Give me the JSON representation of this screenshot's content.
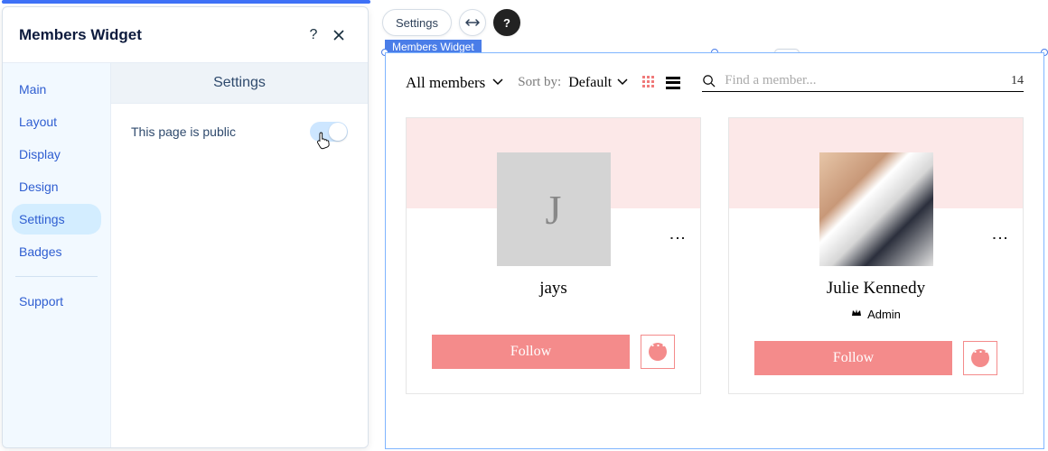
{
  "panel": {
    "title": "Members Widget",
    "help": "?",
    "content_heading": "Settings",
    "toggle_label": "This page is public"
  },
  "sidebar": {
    "items": [
      "Main",
      "Layout",
      "Display",
      "Design",
      "Settings",
      "Badges"
    ],
    "support": "Support"
  },
  "pills": {
    "settings": "Settings",
    "help": "?"
  },
  "canvas": {
    "label": "Members Widget"
  },
  "widget": {
    "filter_label": "All members",
    "sort_prefix": "Sort by:",
    "sort_value": "Default",
    "search_placeholder": "Find a member...",
    "count": "14",
    "follow": "Follow"
  },
  "members": [
    {
      "name": "jays",
      "initial": "J",
      "role": ""
    },
    {
      "name": "Julie Kennedy",
      "initial": "",
      "role": "Admin"
    }
  ]
}
